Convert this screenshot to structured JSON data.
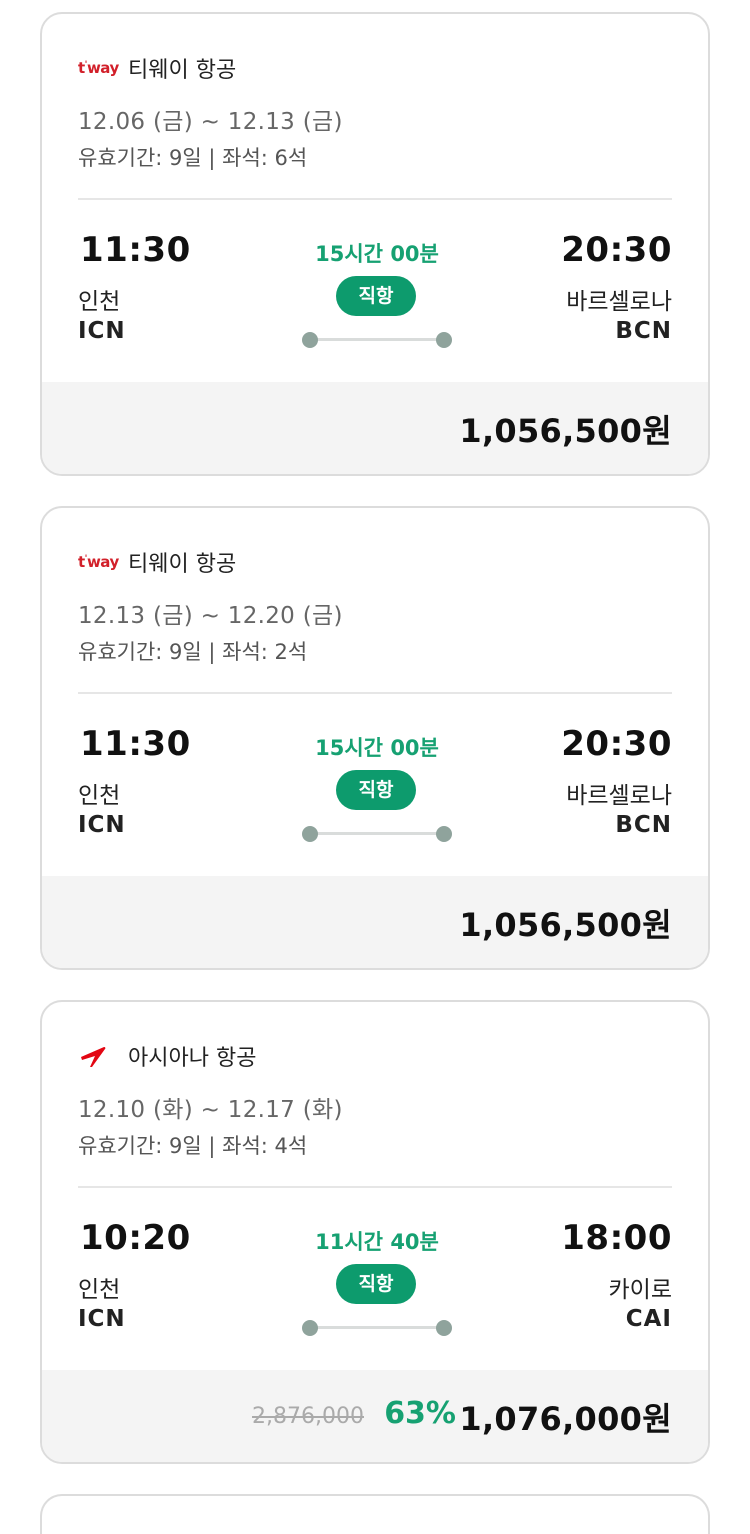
{
  "cards": [
    {
      "airline": {
        "logo": "tway-logo",
        "logo_text": "t'way",
        "name": "티웨이 항공"
      },
      "dates": "12.06 (금) ~ 12.13 (금)",
      "meta": "유효기간: 9일 | 좌석: 6석",
      "departure": {
        "time": "11:30",
        "city": "인천",
        "code": "ICN"
      },
      "arrival": {
        "time": "20:30",
        "city": "바르셀로나",
        "code": "BCN"
      },
      "duration": "15시간 00분",
      "flight_type": "직항",
      "price": "1,056,500원"
    },
    {
      "airline": {
        "logo": "tway-logo",
        "logo_text": "t'way",
        "name": "티웨이 항공"
      },
      "dates": "12.13 (금) ~ 12.20 (금)",
      "meta": "유효기간: 9일 | 좌석: 2석",
      "departure": {
        "time": "11:30",
        "city": "인천",
        "code": "ICN"
      },
      "arrival": {
        "time": "20:30",
        "city": "바르셀로나",
        "code": "BCN"
      },
      "duration": "15시간 00분",
      "flight_type": "직항",
      "price": "1,056,500원"
    },
    {
      "airline": {
        "logo": "asiana-logo",
        "name": "아시아나 항공"
      },
      "dates": "12.10 (화) ~ 12.17 (화)",
      "meta": "유효기간: 9일 | 좌석: 4석",
      "departure": {
        "time": "10:20",
        "city": "인천",
        "code": "ICN"
      },
      "arrival": {
        "time": "18:00",
        "city": "카이로",
        "code": "CAI"
      },
      "duration": "11시간 40분",
      "flight_type": "직항",
      "original_price": "2,876,000",
      "discount": "63%",
      "price": "1,076,000원"
    }
  ],
  "colors": {
    "accent_green": "#16a172",
    "badge_green": "#0d9b6d",
    "tway_red": "#d2202a",
    "asiana_red": "#e30613"
  }
}
